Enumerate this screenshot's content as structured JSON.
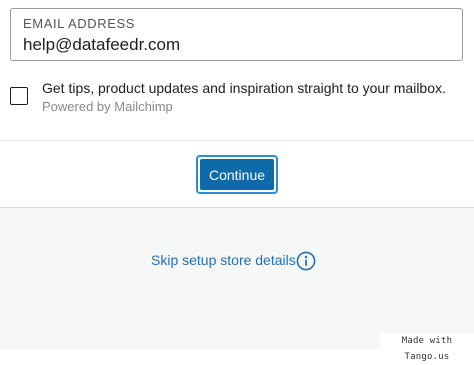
{
  "email": {
    "label": "EMAIL ADDRESS",
    "value": "help@datafeedr.com"
  },
  "consent": {
    "checked": false,
    "text": "Get tips, product updates and inspiration straight to your mailbox.",
    "powered_by": "Powered by Mailchimp"
  },
  "actions": {
    "continue_label": "Continue",
    "skip_label": "Skip setup store details"
  },
  "icons": {
    "info": "info-circle-icon"
  },
  "colors": {
    "primary": "#0e6aa8",
    "link": "#2271b1",
    "footer_bg": "#f6f7f7"
  },
  "watermark": {
    "text": "Made with Tango.us"
  }
}
